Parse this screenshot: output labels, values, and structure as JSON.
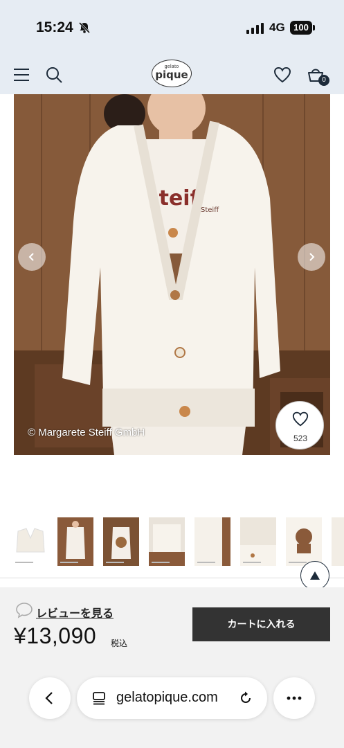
{
  "status_bar": {
    "time": "15:24",
    "network": "4G",
    "battery": "100"
  },
  "header": {
    "logo_small": "gelato",
    "logo_main": "pique",
    "cart_count": "0",
    "icons": [
      "menu-icon",
      "search-icon",
      "heart-icon",
      "cart-icon"
    ]
  },
  "hero": {
    "copyright": "© Margarete Steiff GmbH",
    "favorite_count": "523"
  },
  "thumbnails": {
    "count": 8
  },
  "purchase": {
    "review_label": "レビューを見る",
    "price": "¥13,090",
    "tax_label": "税込",
    "cart_button": "カートに入れる"
  },
  "browser": {
    "url": "gelatopique.com"
  },
  "colors": {
    "header_bg": "#e6ecf3",
    "button_dark": "#333333",
    "accent_navy": "#1d2b3a"
  }
}
